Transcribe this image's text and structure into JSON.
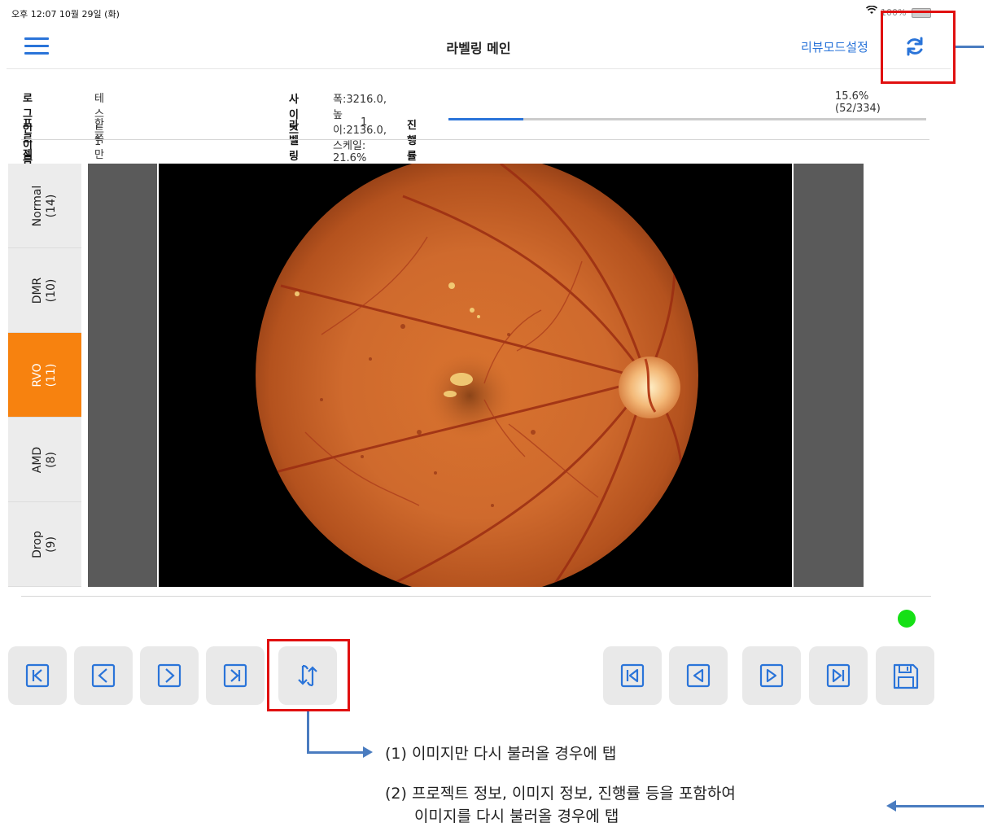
{
  "status_bar": {
    "time": "오후 12:07   10월 29일 (화)",
    "battery": "100%"
  },
  "nav": {
    "title": "라벨링 메인",
    "review_mode": "리뷰모드설정",
    "menu_icon": "hamburger-menu-icon",
    "refresh_icon": "refresh-icon"
  },
  "info": {
    "login_label": "로그인이름",
    "login_value": "테스트1",
    "project_label": "프로젝트명",
    "project_value": "한쪽만라벨",
    "size_label": "사이즈",
    "size_value": "폭:3216.0,높이:2136.0,스케일: 21.6%",
    "round_label": "라벨링 차수",
    "round_value": "1",
    "progress_label": "진행률",
    "progress_text": "15.6%(52/334)",
    "progress_fraction": 0.156
  },
  "tabs": [
    {
      "name": "Normal",
      "count": "(14)",
      "active": false
    },
    {
      "name": "DMR",
      "count": "(10)",
      "active": false
    },
    {
      "name": "RVO",
      "count": "(11)",
      "active": true
    },
    {
      "name": "AMD",
      "count": "(8)",
      "active": false
    },
    {
      "name": "Drop",
      "count": "(9)",
      "active": false
    }
  ],
  "buttons_left": [
    "first-page-icon",
    "prev-icon",
    "next-icon",
    "last-page-icon",
    "reload-image-icon"
  ],
  "buttons_right": [
    "skip-first-icon",
    "play-back-icon",
    "play-forward-icon",
    "skip-last-icon",
    "save-icon"
  ],
  "status_color": "#16e016",
  "accent": "#2a74d9",
  "active_tab_color": "#f7820f",
  "annotations": {
    "note1": "(1) 이미지만 다시 불러올 경우에 탭",
    "note2_line1": "(2) 프로젝트 정보, 이미지 정보, 진행률 등을 포함하여",
    "note2_line2": "이미지를 다시 불러올 경우에 탭"
  }
}
